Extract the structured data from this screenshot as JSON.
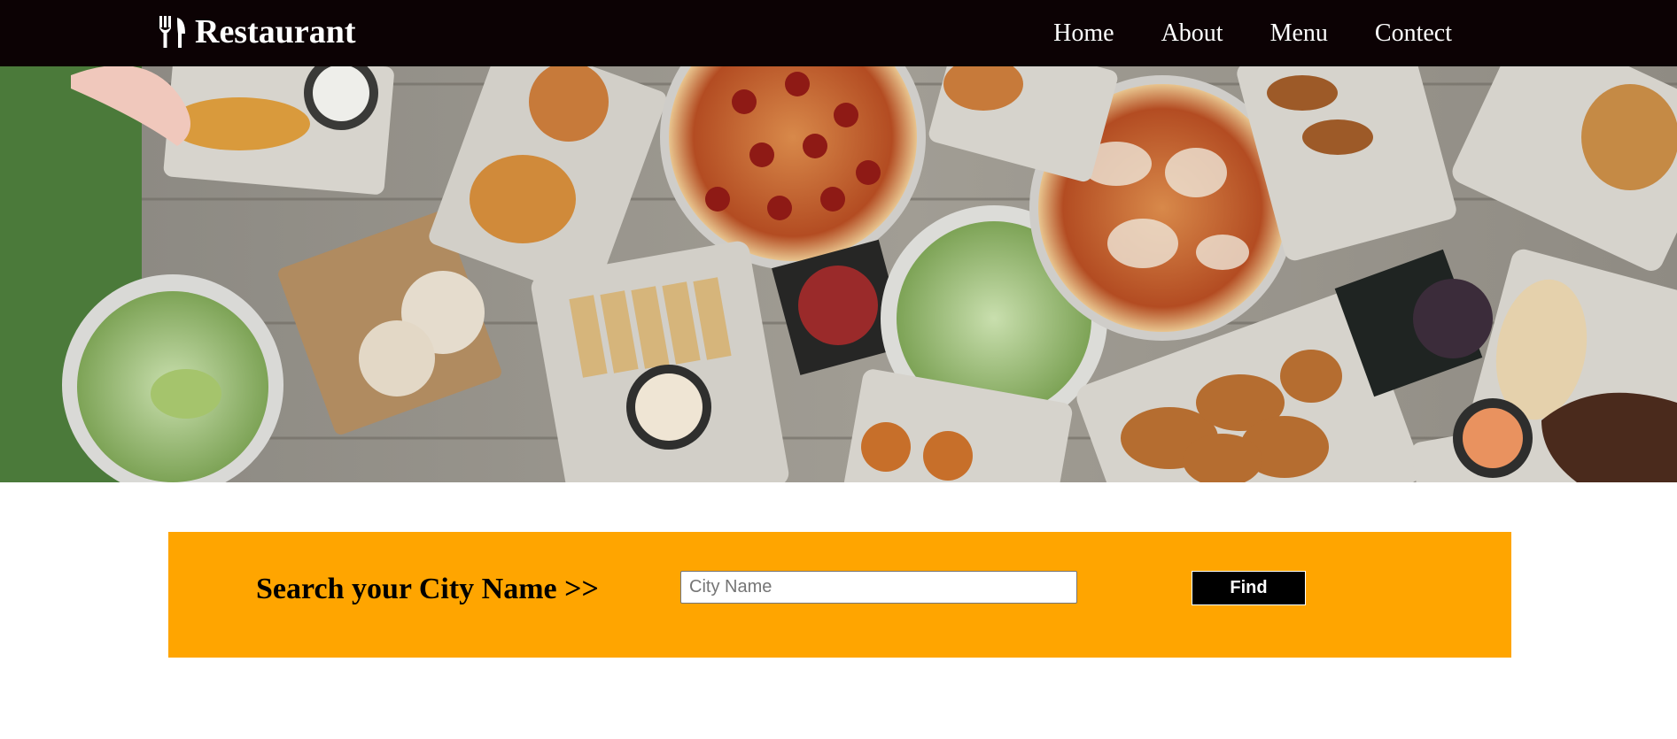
{
  "navbar": {
    "brand_icon": "utensils-icon",
    "brand_name": "Restaurant",
    "links": [
      {
        "label": "Home"
      },
      {
        "label": "About"
      },
      {
        "label": "Menu"
      },
      {
        "label": "Contect"
      }
    ]
  },
  "hero": {
    "image": "food-table-photo"
  },
  "search": {
    "label": "Search your City Name >>",
    "input_placeholder": "City Name",
    "input_value": "",
    "button_label": "Find"
  },
  "colors": {
    "navbar_bg": "#0c0204",
    "panel_bg": "#ffa500",
    "button_bg": "#000000",
    "text_light": "#ffffff"
  }
}
